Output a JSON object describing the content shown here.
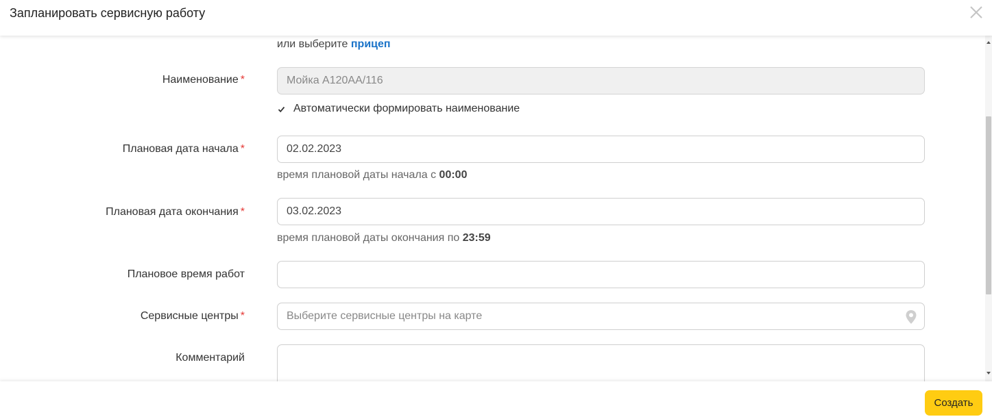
{
  "dialog": {
    "title": "Запланировать сервисную работу",
    "close_icon": "close-icon"
  },
  "form": {
    "trailer_prefix": "или выберите",
    "trailer_link": "прицеп",
    "name": {
      "label": "Наименование",
      "required_mark": "*",
      "value": "Мойка А120АА/116",
      "disabled": true
    },
    "auto_name": {
      "checked": true,
      "label": "Автоматически формировать наименование"
    },
    "start_date": {
      "label": "Плановая дата начала",
      "required_mark": "*",
      "value": "02.02.2023",
      "hint_prefix": "время плановой даты начала с",
      "hint_time": "00:00"
    },
    "end_date": {
      "label": "Плановая дата окончания",
      "required_mark": "*",
      "value": "03.02.2023",
      "hint_prefix": "время плановой даты окончания по",
      "hint_time": "23:59"
    },
    "planned_time": {
      "label": "Плановое время работ",
      "value": ""
    },
    "service_centers": {
      "label": "Сервисные центры",
      "required_mark": "*",
      "placeholder": "Выберите сервисные центры на карте",
      "icon": "map-pin-icon"
    },
    "comment": {
      "label": "Комментарий",
      "value": ""
    }
  },
  "footer": {
    "create_label": "Создать"
  },
  "colors": {
    "accent_button": "#ffcc12",
    "link": "#1a73c8",
    "required": "#e53935"
  }
}
